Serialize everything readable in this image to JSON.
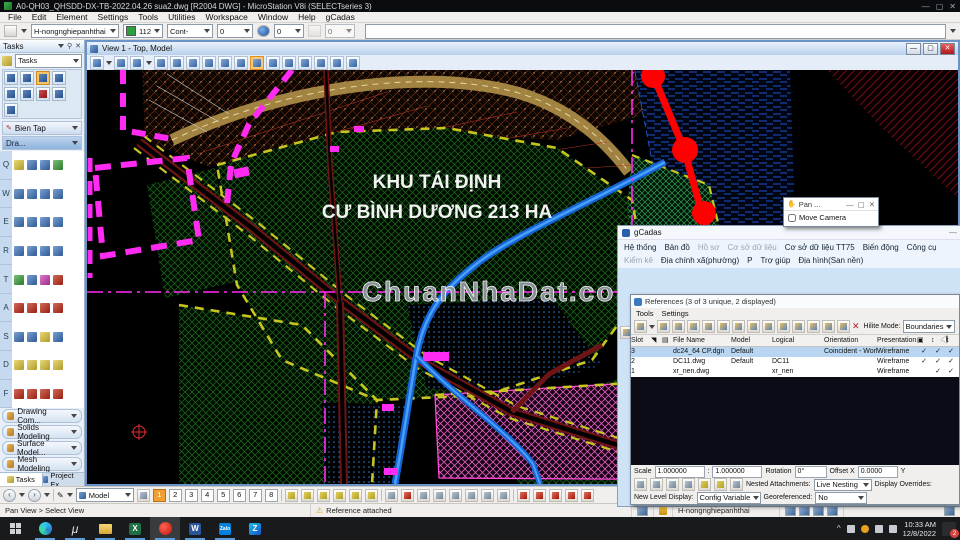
{
  "window": {
    "title": "A0-QH03_QHSDD-DX-TB-2022.04.26 sua2.dwg [R2004 DWG] - MicroStation V8i (SELECTseries 3)",
    "menus": [
      "File",
      "Edit",
      "Element",
      "Settings",
      "Tools",
      "Utilities",
      "Workspace",
      "Window",
      "Help",
      "gCadas"
    ]
  },
  "icons": {
    "min": "—",
    "max": "▢",
    "close": "✕",
    "warning": "⚠",
    "check": "✓",
    "chevron_down": "▾",
    "microstation": "μ",
    "excel": "X",
    "word": "W",
    "zalo": "Zalo",
    "zalopc": "Z",
    "tray_chevron": "^",
    "cursor": "➤",
    "back": "‹",
    "fwd": "›",
    "pin": "⚲",
    "hand": "✋",
    "pencil": "✎"
  },
  "attributes_toolbar": {
    "level": "H-nongnghiepanhthai",
    "color": "112",
    "style": "Cont-",
    "weight": "0",
    "class_value": "0",
    "transparency": "0"
  },
  "tasks_panel": {
    "title": "Tasks",
    "combo": "Tasks",
    "section_bien_tap": "Bien Tap",
    "section_drawing": "Dra...",
    "letters": [
      "Q",
      "W",
      "E",
      "R",
      "T",
      "A",
      "S",
      "D",
      "F"
    ],
    "collapsed": [
      "Drawing Com...",
      "Solids Modeling",
      "Surface Model...",
      "Mesh Modeling"
    ],
    "tabs": [
      "Tasks",
      "Project Ex..."
    ]
  },
  "view_window": {
    "title": "View 1 - Top, Model"
  },
  "map": {
    "label_line1": "KHU TÁI ĐỊNH",
    "label_line2": "CƯ BÌNH DƯƠNG 213 HA",
    "watermark": "ChuanNhaDat.com"
  },
  "pan_dialog": {
    "title": "Pan ...",
    "move_camera": "Move Camera"
  },
  "gcadas": {
    "title": "gCadas",
    "menus_row1": [
      "Hệ thống",
      "Bản đồ",
      "Hồ sơ",
      "Cơ sở dữ liệu",
      "Cơ sở dữ liệu TT75",
      "Biến động",
      "Công cụ",
      "Kiểm kê",
      "Địa chính xã(phường)",
      "P"
    ],
    "menus_row2": [
      "Trợ giúp",
      "Địa hình(San nền)"
    ]
  },
  "references": {
    "title": "References (3 of 3 unique, 2 displayed)",
    "menu_tools": "Tools",
    "menu_settings": "Settings",
    "hilite_label": "Hilite Mode:",
    "hilite_value": "Boundaries",
    "columns": {
      "slot": "Slot",
      "file": "File Name",
      "model": "Model",
      "logical": "Logical",
      "orientation": "Orientation",
      "presentation": "Presentation"
    },
    "rows": [
      {
        "slot": "3",
        "file": "dc24_64 CP.dgn",
        "model": "Default",
        "logical": "",
        "orientation": "Coincident - World",
        "presentation": "Wireframe",
        "checks": [
          "✓",
          "✓",
          "✓"
        ]
      },
      {
        "slot": "2",
        "file": "DC11.dwg",
        "model": "Default",
        "logical": "DC11",
        "orientation": "",
        "presentation": "Wireframe",
        "checks": [
          "✓",
          "✓",
          "✓"
        ]
      },
      {
        "slot": "1",
        "file": "xr_nen.dwg",
        "model": "",
        "logical": "xr_nen",
        "orientation": "",
        "presentation": "Wireframe",
        "checks": [
          "",
          "✓",
          "✓"
        ]
      }
    ],
    "scale_label": "Scale",
    "scale_a": "1.000000",
    "scale_sep": ":",
    "scale_b": "1.000000",
    "rotation_label": "Rotation",
    "rotation": "0°",
    "offset_label": "Offset X",
    "offset_x": "0.0000",
    "offset_y_label": "Y",
    "nested_label": "Nested Attachments:",
    "nested_value": "Live Nesting",
    "overrides_label": "Display Overrides:",
    "newlevel_label": "New Level Display:",
    "newlevel_value": "Config Variable",
    "georef_label": "Georeferenced:",
    "georef_value": "No"
  },
  "bottom_bar": {
    "model_label": "Model",
    "views": [
      "1",
      "2",
      "3",
      "4",
      "5",
      "6",
      "7",
      "8"
    ]
  },
  "status_bar": {
    "left": "Pan View > Select View",
    "message": "Reference attached",
    "level": "H-nongnghiepanhthai"
  },
  "taskbar": {
    "time": "10:33 AM",
    "date": "12/8/2022",
    "badge": "2"
  }
}
